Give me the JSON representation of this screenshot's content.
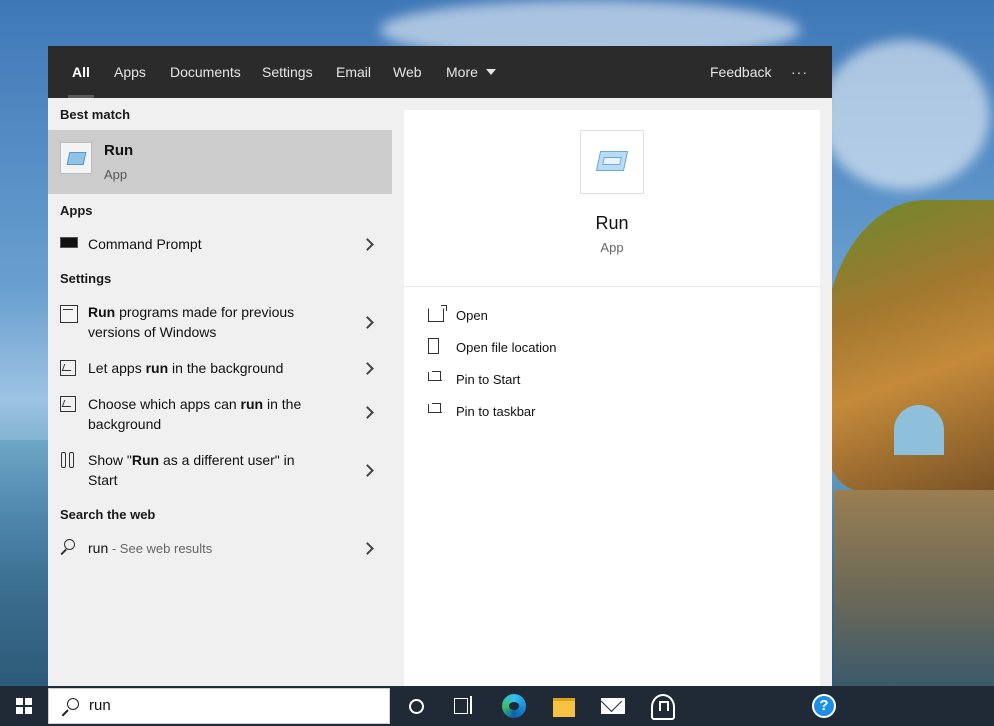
{
  "tabs": [
    {
      "label": "All",
      "active": true
    },
    {
      "label": "Apps"
    },
    {
      "label": "Documents"
    },
    {
      "label": "Settings"
    },
    {
      "label": "Email"
    },
    {
      "label": "Web"
    },
    {
      "label": "More"
    }
  ],
  "topbar": {
    "feedback_label": "Feedback",
    "more_options_label": "···"
  },
  "sections": {
    "best_match": "Best match",
    "apps": "Apps",
    "settings": "Settings",
    "search_web": "Search the web"
  },
  "best_match": {
    "title": "Run",
    "subtitle": "App"
  },
  "apps": [
    {
      "label": "Command Prompt"
    }
  ],
  "settings": [
    {
      "bold": "Run",
      "rest_line1": " programs made for previous",
      "line2": "versions of Windows"
    },
    {
      "pre": "Let apps ",
      "bold": "run",
      "post": " in the background"
    },
    {
      "pre": "Choose which apps can ",
      "bold": "run",
      "post": " in the",
      "line2": "background"
    },
    {
      "pre": "Show \"",
      "bold": "Run",
      "post": " as a different user\" in",
      "line2": "Start"
    }
  ],
  "web": {
    "query": "run",
    "suffix": " - See web results"
  },
  "detail": {
    "title": "Run",
    "subtitle": "App",
    "actions": [
      {
        "label": "Open",
        "icon": "open-icon"
      },
      {
        "label": "Open file location",
        "icon": "folder-icon"
      },
      {
        "label": "Pin to Start",
        "icon": "pin-icon"
      },
      {
        "label": "Pin to taskbar",
        "icon": "pin-icon"
      }
    ]
  },
  "taskbar": {
    "search_value": "run",
    "items": [
      "cortana-icon",
      "task-view-icon",
      "edge-icon",
      "file-explorer-icon",
      "mail-icon",
      "store-icon",
      "help-icon"
    ],
    "help_glyph": "?"
  },
  "colors": {
    "topbar": "#2b2b2b",
    "left_bg": "#f0f0f0",
    "selected": "#cccccc",
    "taskbar": "#1f2a36",
    "accent": "#1e8fe3"
  }
}
